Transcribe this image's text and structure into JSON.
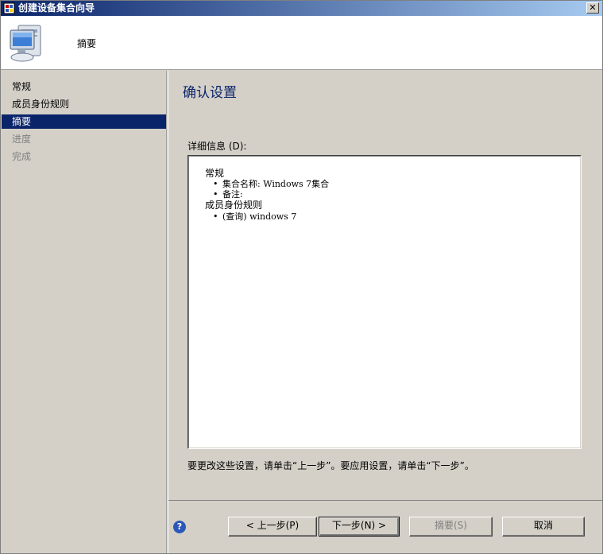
{
  "window": {
    "title": "创建设备集合向导",
    "close_label": "✕"
  },
  "header": {
    "title": "摘要"
  },
  "sidebar": {
    "items": [
      {
        "label": "常规",
        "state": "done"
      },
      {
        "label": "成员身份规则",
        "state": "done"
      },
      {
        "label": "摘要",
        "state": "active"
      },
      {
        "label": "进度",
        "state": "pending"
      },
      {
        "label": "完成",
        "state": "pending"
      }
    ]
  },
  "main": {
    "heading": "确认设置",
    "details_label": "详细信息 (D):",
    "details": {
      "section1": "常规",
      "bullet1": "集合名称: Windows 7集合",
      "bullet2": "备注:",
      "section2": "成员身份规则",
      "bullet3": "(查询) windows 7",
      "bullet_glyph": "•"
    },
    "instructions": "要更改这些设置，请单击“上一步”。要应用设置，请单击“下一步”。"
  },
  "footer": {
    "help_glyph": "?",
    "prev_label": "< 上一步(P)",
    "next_label": "下一步(N) >",
    "summary_label": "摘要(S)",
    "cancel_label": "取消"
  },
  "colors": {
    "accent": "#0a246a",
    "heading": "#0a246a",
    "disabled_text": "#808080"
  }
}
